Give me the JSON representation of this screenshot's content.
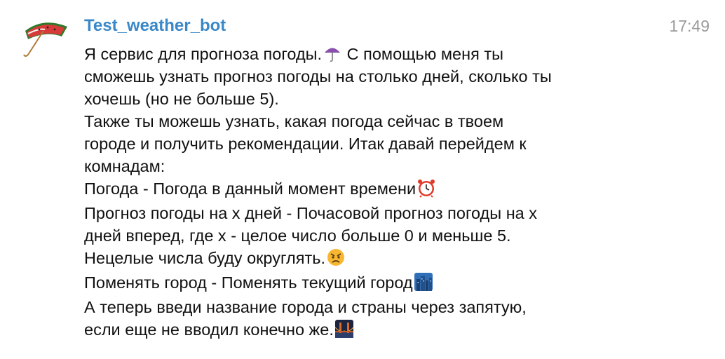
{
  "message": {
    "sender": "Test_weather_bot",
    "time": "17:49",
    "lines": [
      "Я сервис для прогноза погоды.",
      " С помощью меня ты",
      "сможешь узнать прогноз погоды на столько дней, сколько ты",
      "хочешь (но не больше 5).",
      "Также ты можешь узнать, какая погода сейчас в твоем",
      "городе и получить рекомендации. Итак давай перейдем к",
      "комнадам:",
      "Погода - Погода в данный момент времени",
      "Прогноз погоды на x дней - Почасовой прогноз погоды на x",
      "дней вперед, где x - целое число больше 0 и меньше 5.",
      "Нецелые числа буду округлять.",
      "Поменять город - Поменять текущий город",
      "А теперь введи название города и страны через запятую,",
      "если еще не вводил конечно же."
    ],
    "icons": {
      "avatar": "watermelon-umbrella-icon",
      "umbrella": "umbrella-icon",
      "clock": "alarm-clock-icon",
      "angry": "angry-face-icon",
      "city": "cityscape-icon",
      "bridge": "bridge-at-night-icon"
    }
  }
}
